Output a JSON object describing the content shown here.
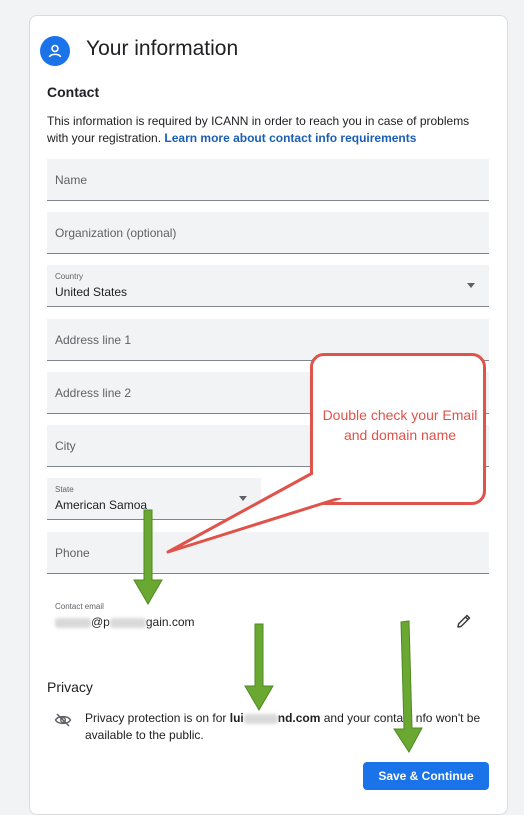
{
  "header": {
    "title": "Your information",
    "icon": "person-icon"
  },
  "contact": {
    "heading": "Contact",
    "description": "This information is required by ICANN in order to reach you in case of problems with your registration.",
    "link": "Learn more about contact info requirements"
  },
  "fields": {
    "name": {
      "placeholder": "Name"
    },
    "organization": {
      "placeholder": "Organization (optional)"
    },
    "country": {
      "label": "Country",
      "value": "United States"
    },
    "address1": {
      "placeholder": "Address line 1"
    },
    "address2": {
      "placeholder": "Address line 2"
    },
    "city": {
      "placeholder": "City"
    },
    "state": {
      "label": "State",
      "value": "American Samoa"
    },
    "phone": {
      "placeholder": "Phone"
    }
  },
  "contact_email": {
    "label": "Contact email",
    "visible_at": "@p",
    "visible_domain": "gain.com"
  },
  "privacy": {
    "heading": "Privacy",
    "text_before": "Privacy protection is on for ",
    "domain_start": "lui",
    "domain_end": "nd.com",
    "text_mid": " and your contact ",
    "text_after": "nfo won't be available to the public."
  },
  "actions": {
    "save_label": "Save & Continue"
  },
  "annotation": {
    "callout_text": "Double check your Email and domain name",
    "arrow_color": "#6aa832",
    "callout_color": "#e0534a"
  },
  "colors": {
    "accent": "#1a73e8",
    "link": "#1a5fb4"
  }
}
